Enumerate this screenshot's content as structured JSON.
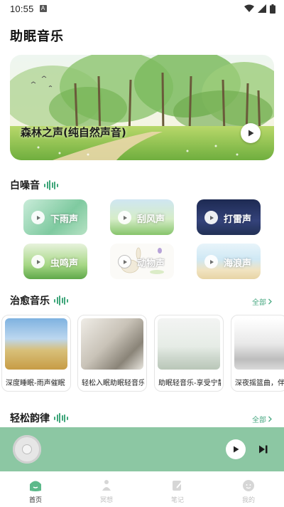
{
  "status_bar": {
    "time": "10:55",
    "notification_letter": "A"
  },
  "page": {
    "title": "助眠音乐"
  },
  "banner": {
    "title": "森林之声(纯自然声音)"
  },
  "white_noise": {
    "title": "白噪音",
    "items": [
      {
        "label": "下雨声"
      },
      {
        "label": "刮风声"
      },
      {
        "label": "打雷声"
      },
      {
        "label": "虫鸣声"
      },
      {
        "label": "动物声"
      },
      {
        "label": "海浪声"
      }
    ]
  },
  "healing_music": {
    "title": "治愈音乐",
    "more_label": "全部",
    "items": [
      {
        "caption": "深度睡眠-雨声催眠"
      },
      {
        "caption": "轻松入眠助眠轻音乐"
      },
      {
        "caption": "助眠轻音乐-享受宁静"
      },
      {
        "caption": "深夜摇篮曲，伴你入眠"
      }
    ]
  },
  "relax_melody": {
    "title": "轻松韵律",
    "more_label": "全部"
  },
  "bottom_nav": {
    "items": [
      {
        "label": "首页",
        "icon": "home-icon",
        "active": true
      },
      {
        "label": "冥想",
        "icon": "meditation-icon",
        "active": false
      },
      {
        "label": "笔记",
        "icon": "note-icon",
        "active": false
      },
      {
        "label": "我的",
        "icon": "profile-icon",
        "active": false
      }
    ]
  },
  "colors": {
    "accent": "#3fa67a",
    "player_bar": "#8cc7a3",
    "link": "#4aa983"
  }
}
